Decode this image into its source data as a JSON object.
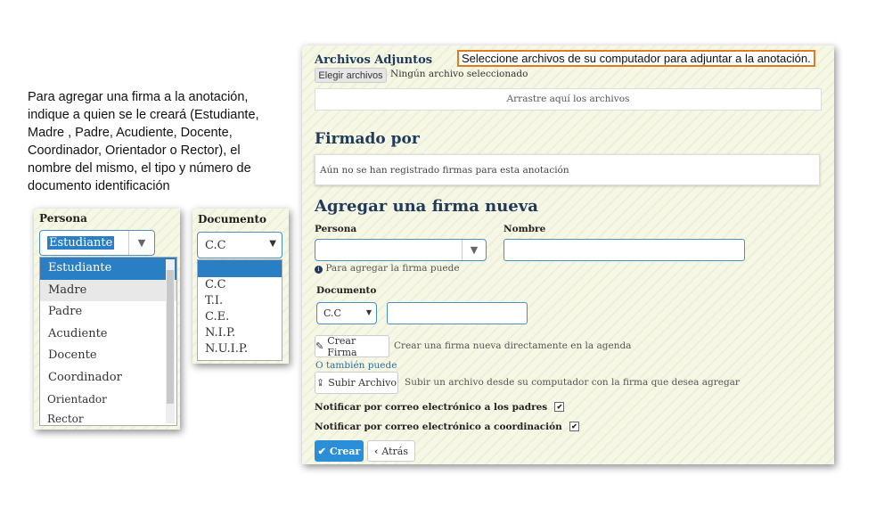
{
  "instructions": "Para agregar una firma a la anotación, indique a quien se le creará (Estudiante, Madre , Padre, Acudiente, Docente, Coordinador, Orientador o Rector), el nombre del mismo, el tipo y número de documento identificación",
  "persona_shot": {
    "label": "Persona",
    "selected": "Estudiante",
    "options": [
      "Estudiante",
      "Madre",
      "Padre",
      "Acudiente",
      "Docente",
      "Coordinador",
      "Orientador",
      "Rector"
    ]
  },
  "documento_shot": {
    "label": "Documento",
    "selected": "C.C",
    "options": [
      "",
      "C.C",
      "T.I.",
      "C.E.",
      "N.I.P.",
      "N.U.I.P."
    ]
  },
  "attachments": {
    "title": "Archivos Adjuntos",
    "callout": "Seleccione archivos de su computador para adjuntar a la anotación.",
    "choose_button": "Elegir archivos",
    "no_file": "Ningún archivo seleccionado",
    "dropzone": "Arrastre aquí los archivos"
  },
  "signed": {
    "title": "Firmado por",
    "empty_message": "Aún no se han registrado firmas para esta anotación"
  },
  "new_signature": {
    "title": "Agregar una firma nueva",
    "persona_label": "Persona",
    "nombre_label": "Nombre",
    "hint": "Para agregar la firma puede",
    "documento_label": "Documento",
    "documento_value": "C.C",
    "create_button": "Crear Firma",
    "create_desc": "Crear una firma nueva directamente en la agenda",
    "or_also": "O también puede",
    "upload_button": "Subir Archivo",
    "upload_desc": "Subir un archivo desde su computador con la firma que desea agregar",
    "notify_parents": "Notificar por correo electrónico a los padres",
    "notify_coord": "Notificar por correo electrónico a coordinación",
    "submit_button": "Crear",
    "back_button": "Atrás"
  },
  "colors": {
    "primary": "#2a8fd8",
    "accent_border": "#e07b1f",
    "heading": "#1f3a5a"
  }
}
